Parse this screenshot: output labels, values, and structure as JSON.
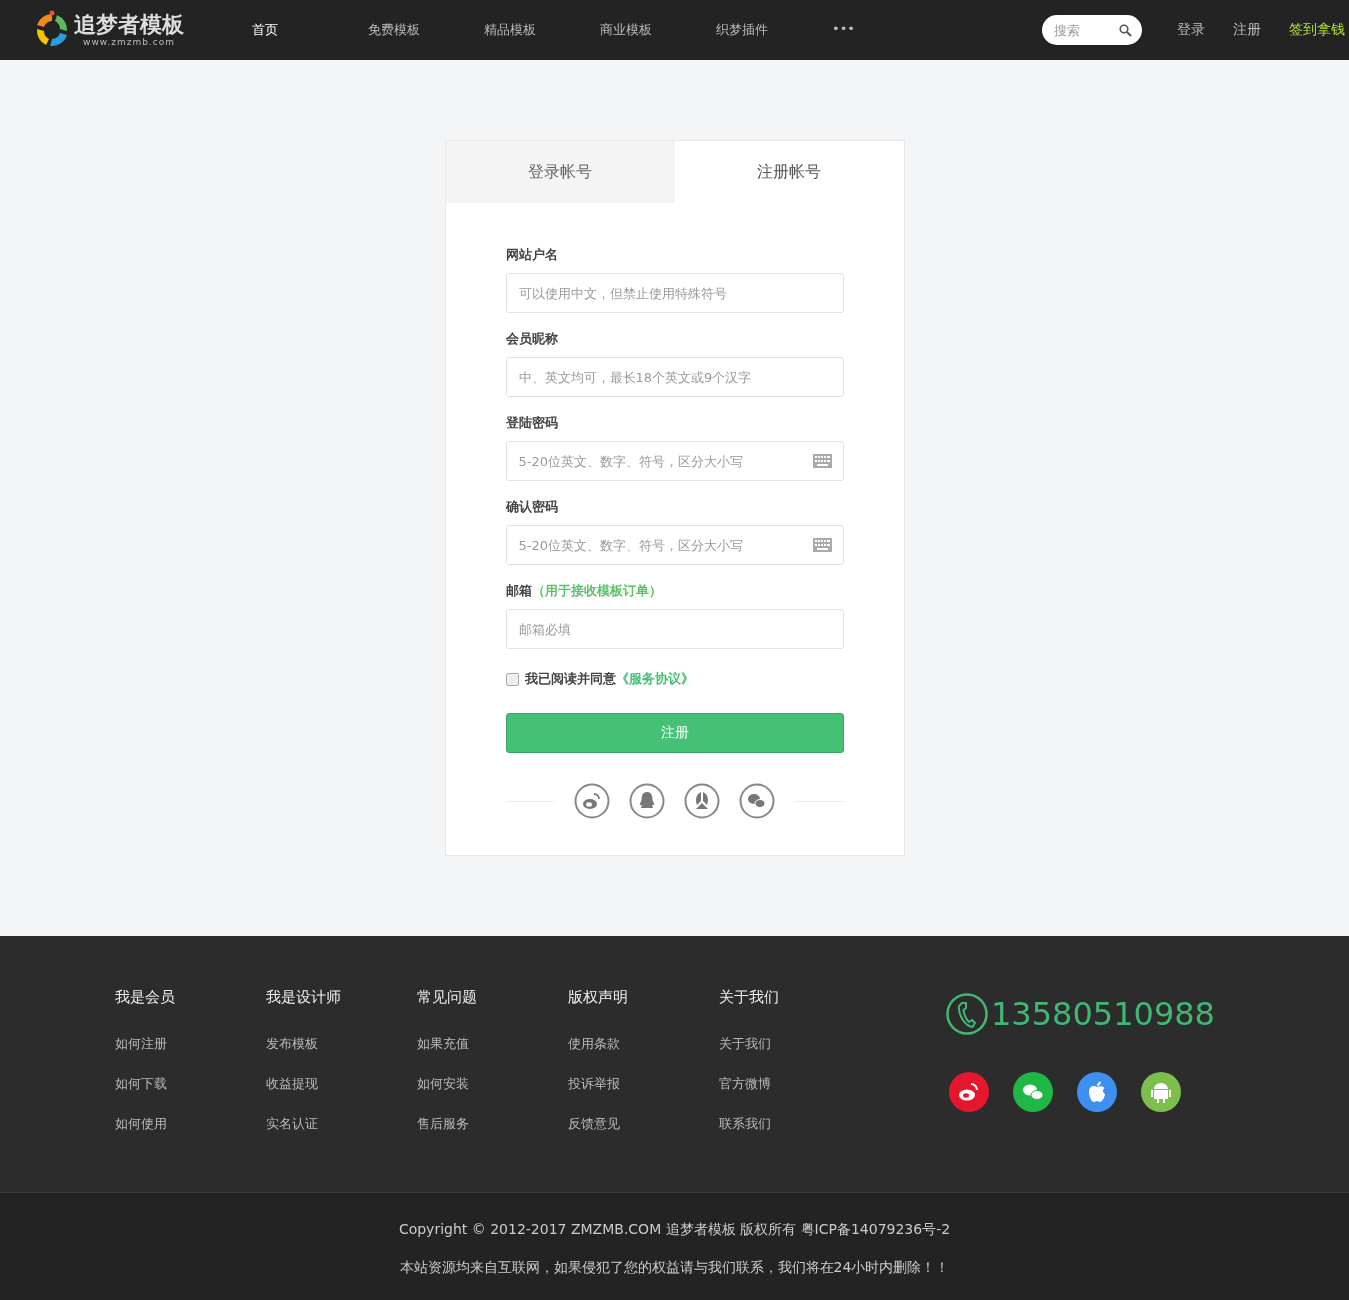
{
  "header": {
    "logo": {
      "name": "追梦者模板",
      "domain": "www.zmzmb.com"
    },
    "nav": [
      {
        "label": "首页",
        "selected": true
      },
      {
        "label": "免费模板",
        "selected": false
      },
      {
        "label": "精品模板",
        "selected": false
      },
      {
        "label": "商业模板",
        "selected": false
      },
      {
        "label": "织梦插件",
        "selected": false
      },
      {
        "label": "•••",
        "selected": false
      }
    ],
    "search": {
      "placeholder": "搜索"
    },
    "user_links": [
      {
        "label": "登录",
        "highlight": false
      },
      {
        "label": "注册",
        "highlight": false
      },
      {
        "label": "签到拿钱",
        "highlight": true
      }
    ]
  },
  "auth_card": {
    "tabs": [
      {
        "label": "登录帐号",
        "selected": false
      },
      {
        "label": "注册帐号",
        "selected": true
      }
    ],
    "fields": [
      {
        "label": "网站户名",
        "placeholder": "可以使用中文，但禁止使用特殊符号",
        "kind": "text"
      },
      {
        "label": "会员昵称",
        "placeholder": "中、英文均可，最长18个英文或9个汉字",
        "kind": "text"
      },
      {
        "label": "登陆密码",
        "placeholder": "5-20位英文、数字、符号，区分大小写",
        "kind": "password"
      },
      {
        "label": "确认密码",
        "placeholder": "5-20位英文、数字、符号，区分大小写",
        "kind": "password"
      },
      {
        "label": "邮箱",
        "note": "（用于接收模板订单）",
        "placeholder": "邮箱必填",
        "kind": "text"
      }
    ],
    "agreement": {
      "checked": false,
      "text": "我已阅读并同意",
      "link": "《服务协议》"
    },
    "submit": "注册"
  },
  "footer": {
    "columns": [
      {
        "title": "我是会员",
        "links": [
          "如何注册",
          "如何下载",
          "如何使用"
        ]
      },
      {
        "title": "我是设计师",
        "links": [
          "发布模板",
          "收益提现",
          "实名认证"
        ]
      },
      {
        "title": "常见问题",
        "links": [
          "如果充值",
          "如何安装",
          "售后服务"
        ]
      },
      {
        "title": "版权声明",
        "links": [
          "使用条款",
          "投诉举报",
          "反馈意见"
        ]
      },
      {
        "title": "关于我们",
        "links": [
          "关于我们",
          "官方微博",
          "联系我们"
        ]
      }
    ],
    "phone": "13580510988",
    "copyright": "Copyright © 2012-2017 ZMZMB.COM 追梦者模板 版权所有 粤ICP备14079236号-2",
    "disclaimer": "本站资源均来自互联网，如果侵犯了您的权益请与我们联系，我们将在24小时内删除！！"
  }
}
